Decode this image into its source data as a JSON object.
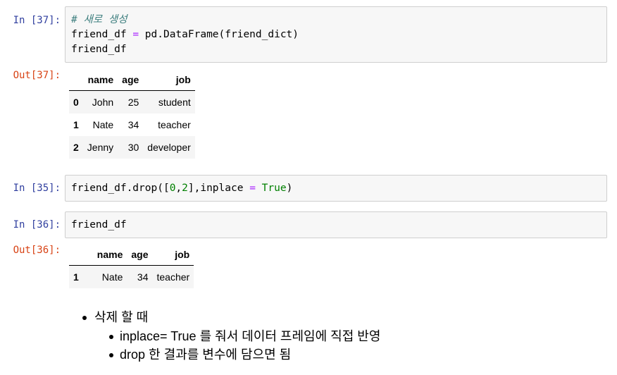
{
  "cells": {
    "c37": {
      "in_prompt": "In [37]:",
      "code": [
        "# 새로 생성",
        "friend_df = pd.DataFrame(friend_dict)",
        "friend_df"
      ],
      "out_prompt": "Out[37]:",
      "table": {
        "columns": [
          "name",
          "age",
          "job"
        ],
        "rows": [
          {
            "index": "0",
            "name": "John",
            "age": "25",
            "job": "student"
          },
          {
            "index": "1",
            "name": "Nate",
            "age": "34",
            "job": "teacher"
          },
          {
            "index": "2",
            "name": "Jenny",
            "age": "30",
            "job": "developer"
          }
        ]
      }
    },
    "c35": {
      "in_prompt": "In [35]:",
      "code": [
        "friend_df.drop([0,2],inplace = True)"
      ]
    },
    "c36": {
      "in_prompt": "In [36]:",
      "code": [
        "friend_df"
      ],
      "out_prompt": "Out[36]:",
      "table": {
        "columns": [
          "name",
          "age",
          "job"
        ],
        "rows": [
          {
            "index": "1",
            "name": "Nate",
            "age": "34",
            "job": "teacher"
          }
        ]
      }
    }
  },
  "markdown": {
    "item": "삭제 할 때",
    "subitems": [
      "inplace= True 를 줘서 데이터 프레임에 직접 반영",
      "drop 한 결과를 변수에 담으면 됨"
    ]
  },
  "colors": {
    "in_prompt": "#303f9f",
    "out_prompt": "#d84315",
    "code_bg": "#f7f7f7",
    "comment": "#408080",
    "operator": "#aa22ff",
    "number_keyword": "#008000"
  }
}
